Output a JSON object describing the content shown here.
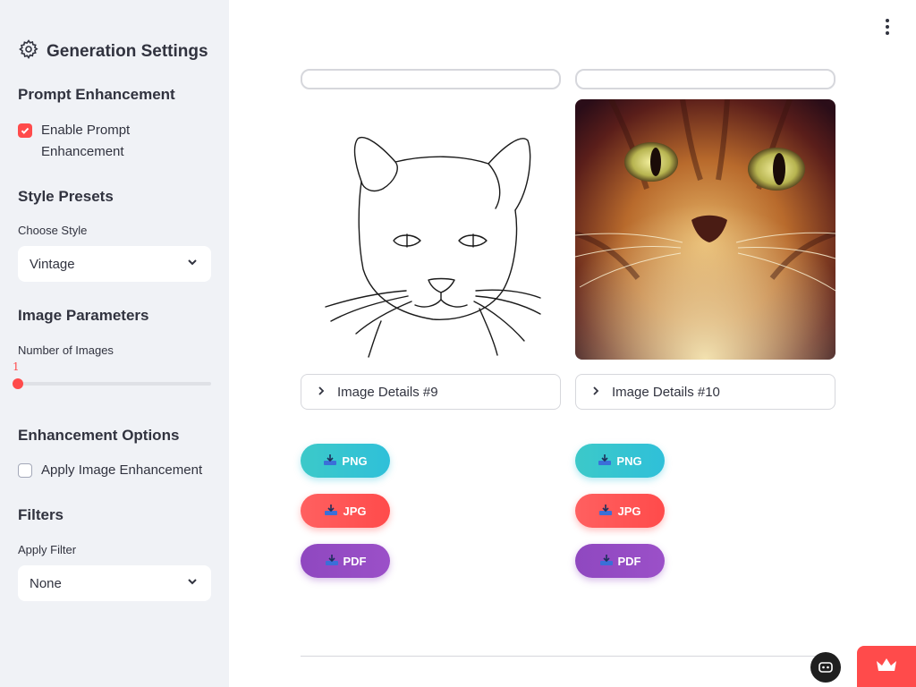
{
  "sidebar": {
    "title": "Generation Settings",
    "prompt_enhancement": {
      "heading": "Prompt Enhancement",
      "checkbox_label": "Enable Prompt Enhancement",
      "checked": true
    },
    "style_presets": {
      "heading": "Style Presets",
      "label": "Choose Style",
      "value": "Vintage"
    },
    "image_parameters": {
      "heading": "Image Parameters",
      "label": "Number of Images",
      "slider_value": "1"
    },
    "enhancement_options": {
      "heading": "Enhancement Options",
      "checkbox_label": "Apply Image Enhancement",
      "checked": false
    },
    "filters": {
      "heading": "Filters",
      "label": "Apply Filter",
      "value": "None"
    }
  },
  "results": [
    {
      "expander_label": "Image Details #9",
      "buttons": {
        "png": "PNG",
        "jpg": "JPG",
        "pdf": "PDF"
      }
    },
    {
      "expander_label": "Image Details #10",
      "buttons": {
        "png": "PNG",
        "jpg": "JPG",
        "pdf": "PDF"
      }
    }
  ],
  "icons": {
    "settings": "gear-icon",
    "menu": "vertical-dots-icon",
    "expander": "chevron-right-icon",
    "download": "inbox-tray-icon",
    "bot": "bot-face-icon",
    "deploy": "crown-icon"
  },
  "colors": {
    "accent": "#ff4b4b",
    "png_button": "#2fc0d9",
    "jpg_button": "#ff4b4b",
    "pdf_button": "#8f48c0",
    "sidebar_bg": "#f0f2f6"
  }
}
